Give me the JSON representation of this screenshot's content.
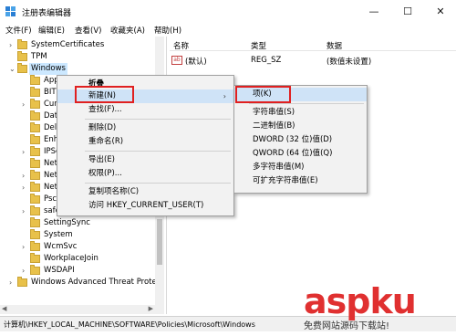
{
  "window": {
    "title": "注册表编辑器"
  },
  "winbtns": {
    "min": "—",
    "max": "☐",
    "close": "✕"
  },
  "menubar": [
    "文件(F)",
    "编辑(E)",
    "查看(V)",
    "收藏夹(A)",
    "帮助(H)"
  ],
  "tree": [
    {
      "label": "SystemCertificates",
      "chev": "›"
    },
    {
      "label": "TPM",
      "chev": ""
    },
    {
      "label": "Windows",
      "chev": "⌄",
      "selected": true
    },
    {
      "label": "Appx",
      "chev": ""
    },
    {
      "label": "BITS",
      "chev": ""
    },
    {
      "label": "Curre",
      "chev": "›"
    },
    {
      "label": "DataC",
      "chev": ""
    },
    {
      "label": "Delive",
      "chev": ""
    },
    {
      "label": "Enhar",
      "chev": ""
    },
    {
      "label": "IPSec",
      "chev": "›"
    },
    {
      "label": "Netw",
      "chev": ""
    },
    {
      "label": "Netw",
      "chev": "›"
    },
    {
      "label": "Netw",
      "chev": "›"
    },
    {
      "label": "Psche",
      "chev": ""
    },
    {
      "label": "safer",
      "chev": "›"
    },
    {
      "label": "SettingSync",
      "chev": ""
    },
    {
      "label": "System",
      "chev": ""
    },
    {
      "label": "WcmSvc",
      "chev": "›"
    },
    {
      "label": "WorkplaceJoin",
      "chev": ""
    },
    {
      "label": "WSDAPI",
      "chev": "›"
    },
    {
      "label": "Windows Advanced Threat Prote",
      "chev": "›"
    }
  ],
  "list": {
    "headers": {
      "name": "名称",
      "type": "类型",
      "data": "数据"
    },
    "rows": [
      {
        "icon": "ab",
        "name": "(默认)",
        "type": "REG_SZ",
        "data": "(数值未设置)"
      }
    ]
  },
  "context_menu": {
    "items": [
      "折叠",
      "新建(N)",
      "查找(F)...",
      "删除(D)",
      "重命名(R)",
      "导出(E)",
      "权限(P)...",
      "复制项名称(C)",
      "访问 HKEY_CURRENT_USER(T)"
    ],
    "arrow": "›"
  },
  "submenu": {
    "items": [
      "项(K)",
      "字符串值(S)",
      "二进制值(B)",
      "DWORD (32 位)值(D)",
      "QWORD (64 位)值(Q)",
      "多字符串值(M)",
      "可扩充字符串值(E)"
    ]
  },
  "status": "计算机\\HKEY_LOCAL_MACHINE\\SOFTWARE\\Policies\\Microsoft\\Windows",
  "watermark": {
    "logo": "aspku",
    "sub": "免费网站源码下载站!"
  },
  "colors": {
    "highlight_box": "#e02020",
    "menu_hover": "#cfe3f7",
    "folder": "#e8c14a"
  }
}
